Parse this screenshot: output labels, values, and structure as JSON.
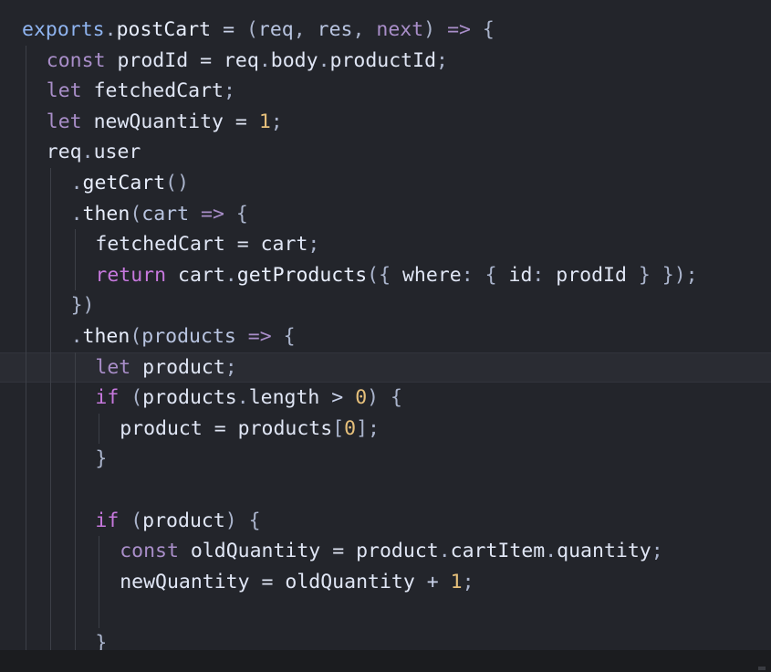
{
  "editor": {
    "language": "javascript",
    "current_line": 12,
    "colors": {
      "background": "#23252b",
      "keyword": "#c678dd",
      "number": "#e6c07b",
      "identifier": "#e0e6f5",
      "object": "#8fb4f0"
    }
  },
  "lines": [
    {
      "indent": 0,
      "guides": 0,
      "tokens": [
        {
          "t": "exports",
          "c": "obj"
        },
        {
          "t": ".",
          "c": "punc"
        },
        {
          "t": "postCart",
          "c": "fn"
        },
        {
          "t": " = ",
          "c": "op"
        },
        {
          "t": "(",
          "c": "punc"
        },
        {
          "t": "req",
          "c": "param"
        },
        {
          "t": ", ",
          "c": "punc"
        },
        {
          "t": "res",
          "c": "param"
        },
        {
          "t": ", ",
          "c": "punc"
        },
        {
          "t": "next",
          "c": "kwlight"
        },
        {
          "t": ") ",
          "c": "punc"
        },
        {
          "t": "=>",
          "c": "arrow"
        },
        {
          "t": " {",
          "c": "punc"
        }
      ]
    },
    {
      "indent": 1,
      "guides": 1,
      "tokens": [
        {
          "t": "const",
          "c": "kwlight"
        },
        {
          "t": " prodId = ",
          "c": "var"
        },
        {
          "t": "req",
          "c": "var"
        },
        {
          "t": ".",
          "c": "punc"
        },
        {
          "t": "body",
          "c": "prop"
        },
        {
          "t": ".",
          "c": "punc"
        },
        {
          "t": "productId",
          "c": "prop"
        },
        {
          "t": ";",
          "c": "punc"
        }
      ]
    },
    {
      "indent": 1,
      "guides": 1,
      "tokens": [
        {
          "t": "let",
          "c": "kwlight"
        },
        {
          "t": " fetchedCart",
          "c": "var"
        },
        {
          "t": ";",
          "c": "punc"
        }
      ]
    },
    {
      "indent": 1,
      "guides": 1,
      "tokens": [
        {
          "t": "let",
          "c": "kwlight"
        },
        {
          "t": " newQuantity = ",
          "c": "var"
        },
        {
          "t": "1",
          "c": "num"
        },
        {
          "t": ";",
          "c": "punc"
        }
      ]
    },
    {
      "indent": 1,
      "guides": 1,
      "tokens": [
        {
          "t": "req",
          "c": "var"
        },
        {
          "t": ".",
          "c": "punc"
        },
        {
          "t": "user",
          "c": "prop"
        }
      ]
    },
    {
      "indent": 2,
      "guides": 2,
      "tokens": [
        {
          "t": ".",
          "c": "punc"
        },
        {
          "t": "getCart",
          "c": "fn"
        },
        {
          "t": "()",
          "c": "punc"
        }
      ]
    },
    {
      "indent": 2,
      "guides": 2,
      "tokens": [
        {
          "t": ".",
          "c": "punc"
        },
        {
          "t": "then",
          "c": "fn"
        },
        {
          "t": "(",
          "c": "punc"
        },
        {
          "t": "cart",
          "c": "param"
        },
        {
          "t": " ",
          "c": "op"
        },
        {
          "t": "=>",
          "c": "arrow"
        },
        {
          "t": " {",
          "c": "punc"
        }
      ]
    },
    {
      "indent": 3,
      "guides": 3,
      "tokens": [
        {
          "t": "fetchedCart = ",
          "c": "var"
        },
        {
          "t": "cart",
          "c": "var"
        },
        {
          "t": ";",
          "c": "punc"
        }
      ]
    },
    {
      "indent": 3,
      "guides": 3,
      "tokens": [
        {
          "t": "return",
          "c": "ctrl"
        },
        {
          "t": " cart",
          "c": "var"
        },
        {
          "t": ".",
          "c": "punc"
        },
        {
          "t": "getProducts",
          "c": "fn"
        },
        {
          "t": "({ ",
          "c": "punc"
        },
        {
          "t": "where",
          "c": "prop"
        },
        {
          "t": ": { ",
          "c": "punc"
        },
        {
          "t": "id",
          "c": "prop"
        },
        {
          "t": ": ",
          "c": "punc"
        },
        {
          "t": "prodId",
          "c": "var"
        },
        {
          "t": " } });",
          "c": "punc"
        }
      ]
    },
    {
      "indent": 2,
      "guides": 2,
      "tokens": [
        {
          "t": "})",
          "c": "punc"
        }
      ]
    },
    {
      "indent": 2,
      "guides": 2,
      "tokens": [
        {
          "t": ".",
          "c": "punc"
        },
        {
          "t": "then",
          "c": "fn"
        },
        {
          "t": "(",
          "c": "punc"
        },
        {
          "t": "products",
          "c": "param"
        },
        {
          "t": " ",
          "c": "op"
        },
        {
          "t": "=>",
          "c": "arrow"
        },
        {
          "t": " {",
          "c": "punc"
        }
      ]
    },
    {
      "indent": 3,
      "guides": 3,
      "tokens": [
        {
          "t": "let",
          "c": "kwlight"
        },
        {
          "t": " product",
          "c": "var"
        },
        {
          "t": ";",
          "c": "punc"
        }
      ]
    },
    {
      "indent": 3,
      "guides": 3,
      "tokens": [
        {
          "t": "if",
          "c": "ctrl"
        },
        {
          "t": " (",
          "c": "punc"
        },
        {
          "t": "products",
          "c": "var"
        },
        {
          "t": ".",
          "c": "punc"
        },
        {
          "t": "length",
          "c": "prop"
        },
        {
          "t": " > ",
          "c": "op"
        },
        {
          "t": "0",
          "c": "num"
        },
        {
          "t": ") {",
          "c": "punc"
        }
      ]
    },
    {
      "indent": 4,
      "guides": 4,
      "tokens": [
        {
          "t": "product = ",
          "c": "var"
        },
        {
          "t": "products",
          "c": "var"
        },
        {
          "t": "[",
          "c": "punc"
        },
        {
          "t": "0",
          "c": "num"
        },
        {
          "t": "];",
          "c": "punc"
        }
      ]
    },
    {
      "indent": 3,
      "guides": 3,
      "tokens": [
        {
          "t": "}",
          "c": "punc"
        }
      ]
    },
    {
      "indent": 3,
      "guides": 3,
      "tokens": []
    },
    {
      "indent": 3,
      "guides": 3,
      "tokens": [
        {
          "t": "if",
          "c": "ctrl"
        },
        {
          "t": " (",
          "c": "punc"
        },
        {
          "t": "product",
          "c": "var"
        },
        {
          "t": ") {",
          "c": "punc"
        }
      ]
    },
    {
      "indent": 4,
      "guides": 4,
      "tokens": [
        {
          "t": "const",
          "c": "kwlight"
        },
        {
          "t": " oldQuantity = ",
          "c": "var"
        },
        {
          "t": "product",
          "c": "var"
        },
        {
          "t": ".",
          "c": "punc"
        },
        {
          "t": "cartItem",
          "c": "prop"
        },
        {
          "t": ".",
          "c": "punc"
        },
        {
          "t": "quantity",
          "c": "prop"
        },
        {
          "t": ";",
          "c": "punc"
        }
      ]
    },
    {
      "indent": 4,
      "guides": 4,
      "tokens": [
        {
          "t": "newQuantity = ",
          "c": "var"
        },
        {
          "t": "oldQuantity",
          "c": "var"
        },
        {
          "t": " + ",
          "c": "op"
        },
        {
          "t": "1",
          "c": "num"
        },
        {
          "t": ";",
          "c": "punc"
        }
      ]
    },
    {
      "indent": 4,
      "guides": 4,
      "tokens": []
    },
    {
      "indent": 3,
      "guides": 3,
      "tokens": [
        {
          "t": "}",
          "c": "punc"
        }
      ]
    }
  ]
}
